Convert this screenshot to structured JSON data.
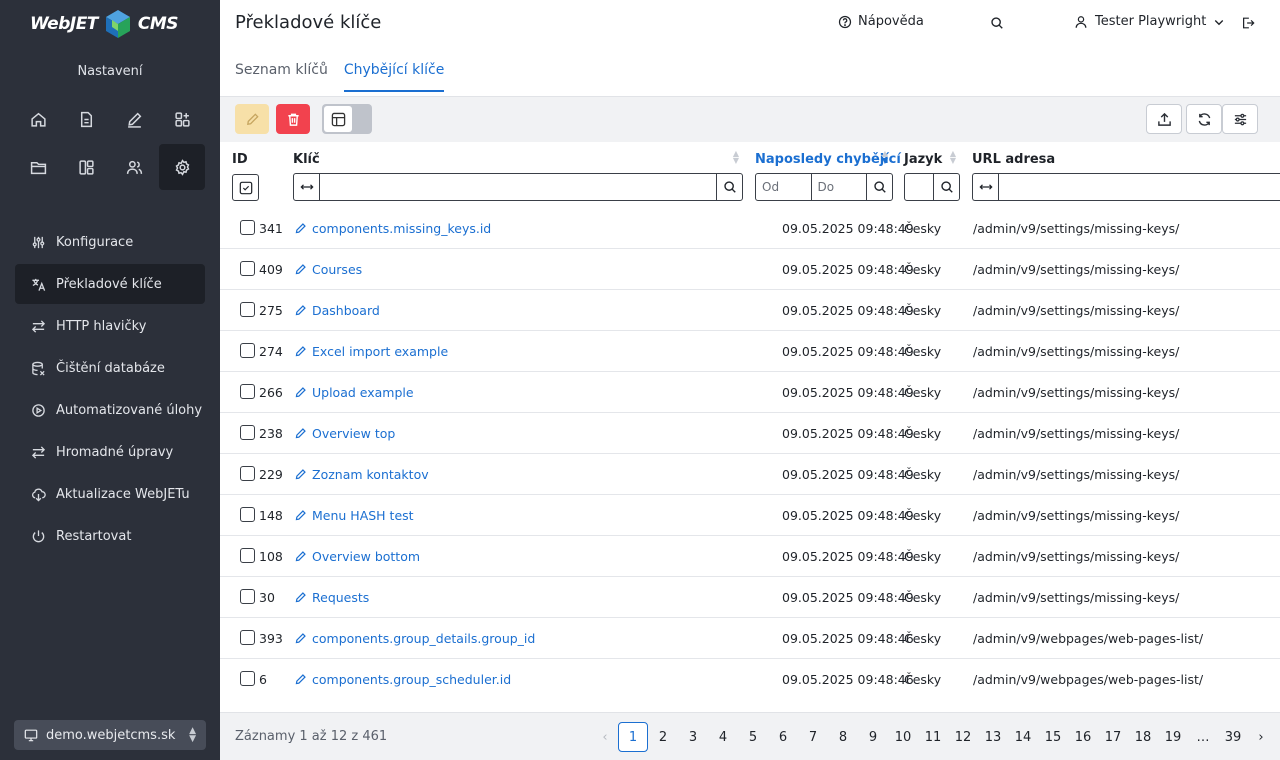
{
  "sidebar": {
    "logo_left": "WebJET",
    "logo_right": "CMS",
    "section_title": "Nastavení",
    "icons": [
      "home-icon",
      "pages-icon",
      "edit-icon",
      "apps-icon",
      "folder-icon",
      "templates-icon",
      "users-icon",
      "settings-icon"
    ],
    "items": [
      {
        "label": "Konfigurace",
        "icon": "sliders-icon"
      },
      {
        "label": "Překladové klíče",
        "icon": "translate-icon"
      },
      {
        "label": "HTTP hlavičky",
        "icon": "arrows-icon"
      },
      {
        "label": "Čištění databáze",
        "icon": "database-icon"
      },
      {
        "label": "Automatizované úlohy",
        "icon": "automation-icon"
      },
      {
        "label": "Hromadné úpravy",
        "icon": "bulk-icon"
      },
      {
        "label": "Aktualizace WebJETu",
        "icon": "cloud-download-icon"
      },
      {
        "label": "Restartovat",
        "icon": "power-icon"
      }
    ],
    "domain": "demo.webjetcms.sk"
  },
  "header": {
    "title": "Překladové klíče",
    "help": "Nápověda",
    "user": "Tester Playwright"
  },
  "tabs": [
    "Seznam klíčů",
    "Chybějící klíče"
  ],
  "table": {
    "columns": {
      "id": "ID",
      "key": "Klíč",
      "last_missing": "Naposledy chybějící",
      "language": "Jazyk",
      "url": "URL adresa"
    },
    "filters": {
      "date_from": "Od",
      "date_to": "Do"
    },
    "rows": [
      {
        "id": "341",
        "key": "components.missing_keys.id",
        "date": "09.05.2025 09:48:49",
        "lang": "Česky",
        "url": "/admin/v9/settings/missing-keys/"
      },
      {
        "id": "409",
        "key": "Courses",
        "date": "09.05.2025 09:48:49",
        "lang": "Česky",
        "url": "/admin/v9/settings/missing-keys/"
      },
      {
        "id": "275",
        "key": "Dashboard",
        "date": "09.05.2025 09:48:49",
        "lang": "Česky",
        "url": "/admin/v9/settings/missing-keys/"
      },
      {
        "id": "274",
        "key": "Excel import example",
        "date": "09.05.2025 09:48:49",
        "lang": "Česky",
        "url": "/admin/v9/settings/missing-keys/"
      },
      {
        "id": "266",
        "key": "Upload example",
        "date": "09.05.2025 09:48:49",
        "lang": "Česky",
        "url": "/admin/v9/settings/missing-keys/"
      },
      {
        "id": "238",
        "key": "Overview top",
        "date": "09.05.2025 09:48:49",
        "lang": "Česky",
        "url": "/admin/v9/settings/missing-keys/"
      },
      {
        "id": "229",
        "key": "Zoznam kontaktov",
        "date": "09.05.2025 09:48:49",
        "lang": "Česky",
        "url": "/admin/v9/settings/missing-keys/"
      },
      {
        "id": "148",
        "key": "Menu HASH test",
        "date": "09.05.2025 09:48:49",
        "lang": "Česky",
        "url": "/admin/v9/settings/missing-keys/"
      },
      {
        "id": "108",
        "key": "Overview bottom",
        "date": "09.05.2025 09:48:49",
        "lang": "Česky",
        "url": "/admin/v9/settings/missing-keys/"
      },
      {
        "id": "30",
        "key": "Requests",
        "date": "09.05.2025 09:48:49",
        "lang": "Česky",
        "url": "/admin/v9/settings/missing-keys/"
      },
      {
        "id": "393",
        "key": "components.group_details.group_id",
        "date": "09.05.2025 09:48:46",
        "lang": "Česky",
        "url": "/admin/v9/webpages/web-pages-list/"
      },
      {
        "id": "6",
        "key": "components.group_scheduler.id",
        "date": "09.05.2025 09:48:46",
        "lang": "Česky",
        "url": "/admin/v9/webpages/web-pages-list/"
      }
    ]
  },
  "footer": {
    "records": "Záznamy 1 až 12 z 461",
    "pages": [
      "1",
      "2",
      "3",
      "4",
      "5",
      "6",
      "7",
      "8",
      "9",
      "10",
      "11",
      "12",
      "13",
      "14",
      "15",
      "16",
      "17",
      "18",
      "19",
      "…",
      "39"
    ],
    "current_page": "1"
  },
  "colors": {
    "sidebar_bg": "#2c303a",
    "accent": "#1b6fd1",
    "delete": "#f2424e",
    "edit_disabled": "#f7e0a8"
  }
}
